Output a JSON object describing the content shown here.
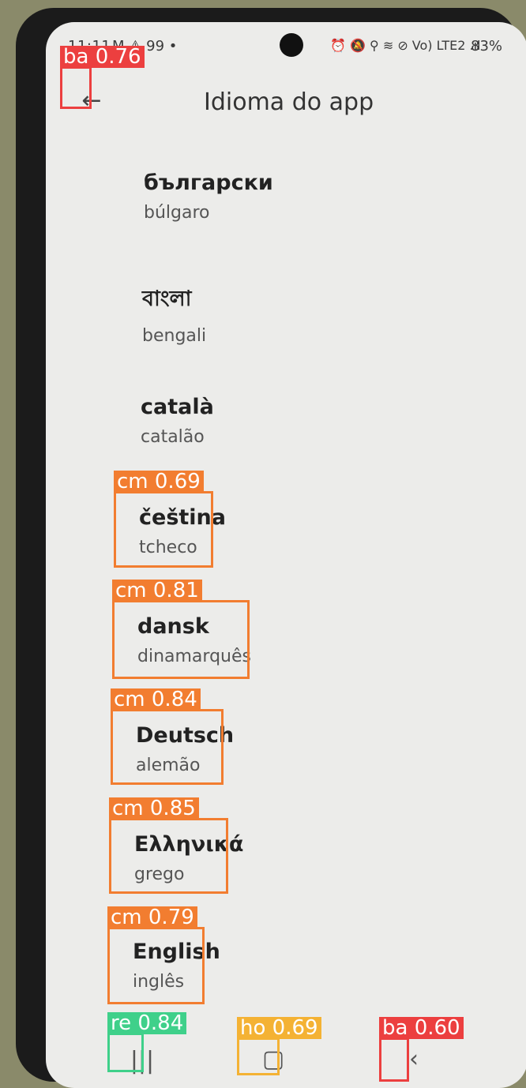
{
  "status_bar": {
    "time": "11:11",
    "notif_text": "M ⚠ 99 •",
    "right_icons": "⏰ 🔕 ⚲ ≋ ⊘ Vo) LTE2 .ıl",
    "battery": "83%"
  },
  "app_bar": {
    "back_glyph": "←",
    "title": "Idioma do app"
  },
  "languages": [
    {
      "native": "български",
      "pt": "búlgaro"
    },
    {
      "native": "বাংলা",
      "pt": "bengali"
    },
    {
      "native": "català",
      "pt": "catalão"
    },
    {
      "native": "čeština",
      "pt": "tcheco"
    },
    {
      "native": "dansk",
      "pt": "dinamarquês"
    },
    {
      "native": "Deutsch",
      "pt": "alemão"
    },
    {
      "native": "Ελληνικά",
      "pt": "grego"
    },
    {
      "native": "English",
      "pt": "inglês"
    }
  ],
  "nav_bar": {
    "recents_glyph": "|||",
    "home_glyph": "▢",
    "back_glyph": "‹"
  },
  "detections": [
    {
      "label": "ba 0.76",
      "color": "red"
    },
    {
      "label": "cm 0.69",
      "color": "orange"
    },
    {
      "label": "cm 0.81",
      "color": "orange"
    },
    {
      "label": "cm 0.84",
      "color": "orange"
    },
    {
      "label": "cm 0.85",
      "color": "orange"
    },
    {
      "label": "cm 0.79",
      "color": "orange"
    },
    {
      "label": "re 0.84",
      "color": "green"
    },
    {
      "label": "ho 0.69",
      "color": "yellow"
    },
    {
      "label": "ba 0.60",
      "color": "red"
    }
  ]
}
